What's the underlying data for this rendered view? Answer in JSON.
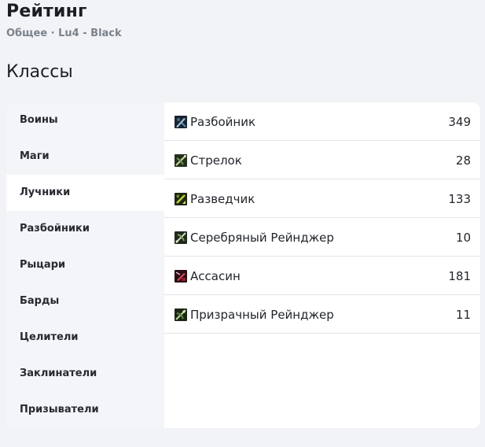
{
  "header": {
    "title": "Рейтинг",
    "breadcrumb": "Общее · Lu4 - Black"
  },
  "section": {
    "title": "Классы"
  },
  "sidebar": {
    "items": [
      {
        "label": "Воины",
        "active": false
      },
      {
        "label": "Маги",
        "active": false
      },
      {
        "label": "Лучники",
        "active": true
      },
      {
        "label": "Разбойники",
        "active": false
      },
      {
        "label": "Рыцари",
        "active": false
      },
      {
        "label": "Барды",
        "active": false
      },
      {
        "label": "Целители",
        "active": false
      },
      {
        "label": "Заклинатели",
        "active": false
      },
      {
        "label": "Призыватели",
        "active": false
      }
    ]
  },
  "classes": [
    {
      "name": "Разбойник",
      "count": "349",
      "icon": "rogue-class-icon",
      "color": "#3b6f8f"
    },
    {
      "name": "Стрелок",
      "count": "28",
      "icon": "hawkeye-class-icon",
      "color": "#4e7a3a"
    },
    {
      "name": "Разведчик",
      "count": "133",
      "icon": "tracker-class-icon",
      "color": "#6a8a1c"
    },
    {
      "name": "Серебряный Рейнджер",
      "count": "10",
      "icon": "silver-ranger-class-icon",
      "color": "#5b7f45"
    },
    {
      "name": "Ассасин",
      "count": "181",
      "icon": "assassin-class-icon",
      "color": "#8a1c2a"
    },
    {
      "name": "Призрачный Рейнджер",
      "count": "11",
      "icon": "phantom-ranger-class-icon",
      "color": "#5c7a3c"
    }
  ]
}
